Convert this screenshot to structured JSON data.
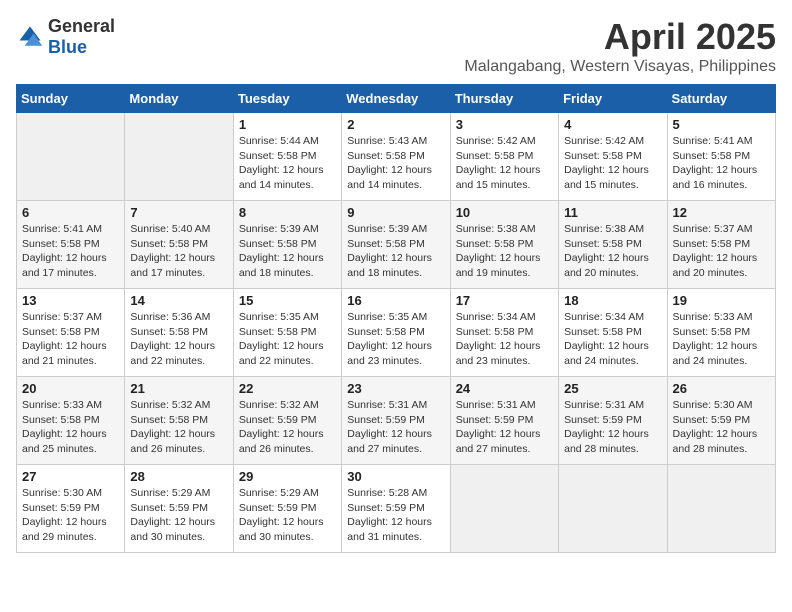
{
  "header": {
    "logo_general": "General",
    "logo_blue": "Blue",
    "month_title": "April 2025",
    "location": "Malangabang, Western Visayas, Philippines"
  },
  "days_of_week": [
    "Sunday",
    "Monday",
    "Tuesday",
    "Wednesday",
    "Thursday",
    "Friday",
    "Saturday"
  ],
  "weeks": [
    [
      {
        "num": "",
        "sunrise": "",
        "sunset": "",
        "daylight": ""
      },
      {
        "num": "",
        "sunrise": "",
        "sunset": "",
        "daylight": ""
      },
      {
        "num": "1",
        "sunrise": "Sunrise: 5:44 AM",
        "sunset": "Sunset: 5:58 PM",
        "daylight": "Daylight: 12 hours and 14 minutes."
      },
      {
        "num": "2",
        "sunrise": "Sunrise: 5:43 AM",
        "sunset": "Sunset: 5:58 PM",
        "daylight": "Daylight: 12 hours and 14 minutes."
      },
      {
        "num": "3",
        "sunrise": "Sunrise: 5:42 AM",
        "sunset": "Sunset: 5:58 PM",
        "daylight": "Daylight: 12 hours and 15 minutes."
      },
      {
        "num": "4",
        "sunrise": "Sunrise: 5:42 AM",
        "sunset": "Sunset: 5:58 PM",
        "daylight": "Daylight: 12 hours and 15 minutes."
      },
      {
        "num": "5",
        "sunrise": "Sunrise: 5:41 AM",
        "sunset": "Sunset: 5:58 PM",
        "daylight": "Daylight: 12 hours and 16 minutes."
      }
    ],
    [
      {
        "num": "6",
        "sunrise": "Sunrise: 5:41 AM",
        "sunset": "Sunset: 5:58 PM",
        "daylight": "Daylight: 12 hours and 17 minutes."
      },
      {
        "num": "7",
        "sunrise": "Sunrise: 5:40 AM",
        "sunset": "Sunset: 5:58 PM",
        "daylight": "Daylight: 12 hours and 17 minutes."
      },
      {
        "num": "8",
        "sunrise": "Sunrise: 5:39 AM",
        "sunset": "Sunset: 5:58 PM",
        "daylight": "Daylight: 12 hours and 18 minutes."
      },
      {
        "num": "9",
        "sunrise": "Sunrise: 5:39 AM",
        "sunset": "Sunset: 5:58 PM",
        "daylight": "Daylight: 12 hours and 18 minutes."
      },
      {
        "num": "10",
        "sunrise": "Sunrise: 5:38 AM",
        "sunset": "Sunset: 5:58 PM",
        "daylight": "Daylight: 12 hours and 19 minutes."
      },
      {
        "num": "11",
        "sunrise": "Sunrise: 5:38 AM",
        "sunset": "Sunset: 5:58 PM",
        "daylight": "Daylight: 12 hours and 20 minutes."
      },
      {
        "num": "12",
        "sunrise": "Sunrise: 5:37 AM",
        "sunset": "Sunset: 5:58 PM",
        "daylight": "Daylight: 12 hours and 20 minutes."
      }
    ],
    [
      {
        "num": "13",
        "sunrise": "Sunrise: 5:37 AM",
        "sunset": "Sunset: 5:58 PM",
        "daylight": "Daylight: 12 hours and 21 minutes."
      },
      {
        "num": "14",
        "sunrise": "Sunrise: 5:36 AM",
        "sunset": "Sunset: 5:58 PM",
        "daylight": "Daylight: 12 hours and 22 minutes."
      },
      {
        "num": "15",
        "sunrise": "Sunrise: 5:35 AM",
        "sunset": "Sunset: 5:58 PM",
        "daylight": "Daylight: 12 hours and 22 minutes."
      },
      {
        "num": "16",
        "sunrise": "Sunrise: 5:35 AM",
        "sunset": "Sunset: 5:58 PM",
        "daylight": "Daylight: 12 hours and 23 minutes."
      },
      {
        "num": "17",
        "sunrise": "Sunrise: 5:34 AM",
        "sunset": "Sunset: 5:58 PM",
        "daylight": "Daylight: 12 hours and 23 minutes."
      },
      {
        "num": "18",
        "sunrise": "Sunrise: 5:34 AM",
        "sunset": "Sunset: 5:58 PM",
        "daylight": "Daylight: 12 hours and 24 minutes."
      },
      {
        "num": "19",
        "sunrise": "Sunrise: 5:33 AM",
        "sunset": "Sunset: 5:58 PM",
        "daylight": "Daylight: 12 hours and 24 minutes."
      }
    ],
    [
      {
        "num": "20",
        "sunrise": "Sunrise: 5:33 AM",
        "sunset": "Sunset: 5:58 PM",
        "daylight": "Daylight: 12 hours and 25 minutes."
      },
      {
        "num": "21",
        "sunrise": "Sunrise: 5:32 AM",
        "sunset": "Sunset: 5:58 PM",
        "daylight": "Daylight: 12 hours and 26 minutes."
      },
      {
        "num": "22",
        "sunrise": "Sunrise: 5:32 AM",
        "sunset": "Sunset: 5:59 PM",
        "daylight": "Daylight: 12 hours and 26 minutes."
      },
      {
        "num": "23",
        "sunrise": "Sunrise: 5:31 AM",
        "sunset": "Sunset: 5:59 PM",
        "daylight": "Daylight: 12 hours and 27 minutes."
      },
      {
        "num": "24",
        "sunrise": "Sunrise: 5:31 AM",
        "sunset": "Sunset: 5:59 PM",
        "daylight": "Daylight: 12 hours and 27 minutes."
      },
      {
        "num": "25",
        "sunrise": "Sunrise: 5:31 AM",
        "sunset": "Sunset: 5:59 PM",
        "daylight": "Daylight: 12 hours and 28 minutes."
      },
      {
        "num": "26",
        "sunrise": "Sunrise: 5:30 AM",
        "sunset": "Sunset: 5:59 PM",
        "daylight": "Daylight: 12 hours and 28 minutes."
      }
    ],
    [
      {
        "num": "27",
        "sunrise": "Sunrise: 5:30 AM",
        "sunset": "Sunset: 5:59 PM",
        "daylight": "Daylight: 12 hours and 29 minutes."
      },
      {
        "num": "28",
        "sunrise": "Sunrise: 5:29 AM",
        "sunset": "Sunset: 5:59 PM",
        "daylight": "Daylight: 12 hours and 30 minutes."
      },
      {
        "num": "29",
        "sunrise": "Sunrise: 5:29 AM",
        "sunset": "Sunset: 5:59 PM",
        "daylight": "Daylight: 12 hours and 30 minutes."
      },
      {
        "num": "30",
        "sunrise": "Sunrise: 5:28 AM",
        "sunset": "Sunset: 5:59 PM",
        "daylight": "Daylight: 12 hours and 31 minutes."
      },
      {
        "num": "",
        "sunrise": "",
        "sunset": "",
        "daylight": ""
      },
      {
        "num": "",
        "sunrise": "",
        "sunset": "",
        "daylight": ""
      },
      {
        "num": "",
        "sunrise": "",
        "sunset": "",
        "daylight": ""
      }
    ]
  ]
}
